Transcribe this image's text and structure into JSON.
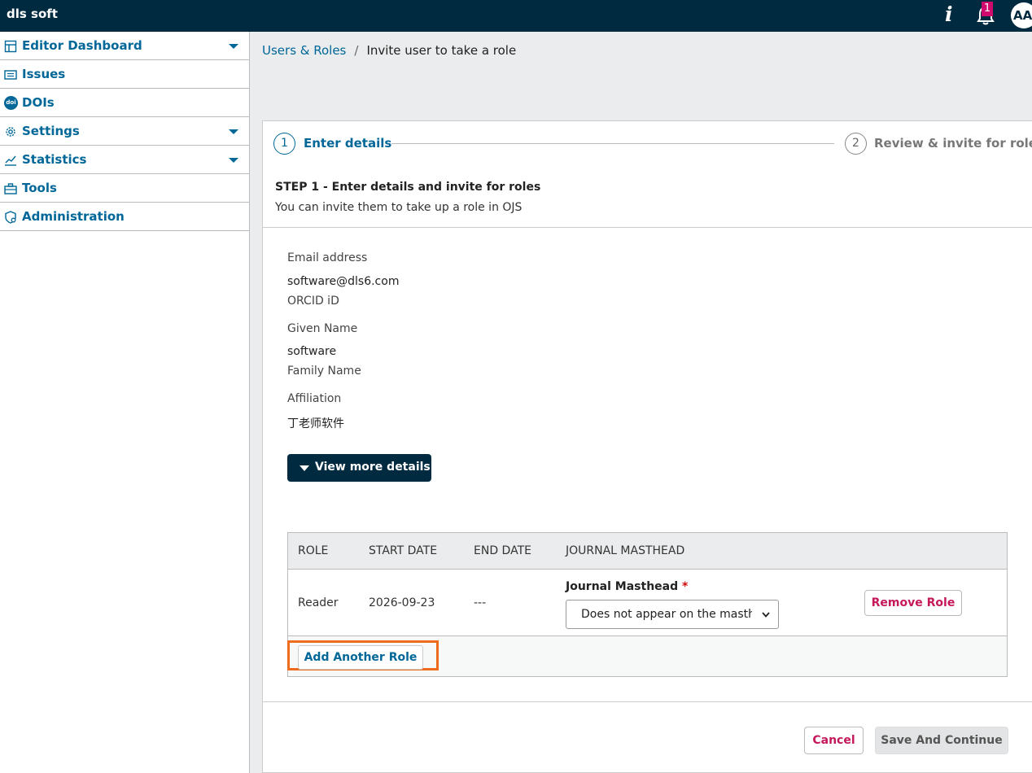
{
  "header": {
    "brand": "dls soft",
    "info_icon": "i",
    "notification_count": "1",
    "avatar_initials": "AA"
  },
  "sidebar": {
    "items": [
      {
        "label": "Editor Dashboard",
        "icon": "dashboard-icon",
        "has_caret": true
      },
      {
        "label": "Issues",
        "icon": "issues-icon",
        "has_caret": false
      },
      {
        "label": "DOIs",
        "icon": "doi-icon",
        "badge_text": "doi",
        "has_caret": false
      },
      {
        "label": "Settings",
        "icon": "gear-icon",
        "has_caret": true
      },
      {
        "label": "Statistics",
        "icon": "chart-icon",
        "has_caret": true
      },
      {
        "label": "Tools",
        "icon": "toolbox-icon",
        "has_caret": false
      },
      {
        "label": "Administration",
        "icon": "admin-icon",
        "has_caret": false
      }
    ]
  },
  "breadcrumb": {
    "parent": "Users & Roles",
    "separator": "/",
    "current": "Invite user to take a role"
  },
  "stepper": {
    "steps": [
      {
        "number": "1",
        "label": "Enter details",
        "active": true
      },
      {
        "number": "2",
        "label": "Review & invite for roles",
        "active": false
      }
    ]
  },
  "step": {
    "heading": "STEP 1 - Enter details and invite for roles",
    "description": "You can invite them to take up a role in OJS"
  },
  "details": {
    "email_label": "Email address",
    "email_value": "software@dls6.com",
    "orcid_label": "ORCID iD",
    "given_name_label": "Given Name",
    "given_name_value": "software",
    "family_name_label": "Family Name",
    "affiliation_label": "Affiliation",
    "affiliation_value": "丁老师软件",
    "view_more_label": "View more details"
  },
  "roles": {
    "columns": [
      "ROLE",
      "START DATE",
      "END DATE",
      "JOURNAL MASTHEAD"
    ],
    "rows": [
      {
        "role": "Reader",
        "start_date": "2026-09-23",
        "end_date": "---",
        "masthead_label": "Journal Masthead",
        "masthead_required": "*",
        "masthead_value": "Does not appear on the masthead",
        "remove_label": "Remove Role"
      }
    ],
    "add_label": "Add Another Role"
  },
  "actions": {
    "cancel_label": "Cancel",
    "save_label": "Save And Continue"
  },
  "colors": {
    "topbar": "#002a40",
    "link": "#006798",
    "danger": "#c5185b",
    "badge": "#d00a6c",
    "highlight": "#ef6c1d"
  }
}
